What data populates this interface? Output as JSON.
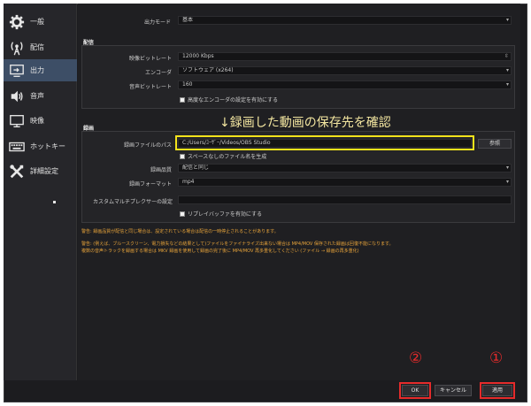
{
  "sidebar": {
    "items": [
      {
        "label": "一般",
        "icon": "gear-icon"
      },
      {
        "label": "配信",
        "icon": "broadcast-icon"
      },
      {
        "label": "出力",
        "icon": "output-icon"
      },
      {
        "label": "音声",
        "icon": "speaker-icon"
      },
      {
        "label": "映像",
        "icon": "monitor-icon"
      },
      {
        "label": "ホットキー",
        "icon": "keyboard-icon"
      },
      {
        "label": "詳細設定",
        "icon": "tools-icon"
      }
    ],
    "active_index": 2
  },
  "output_mode": {
    "label": "出力モード",
    "value": "基本"
  },
  "streaming": {
    "title": "配信",
    "video_bitrate_label": "映像ビットレート",
    "video_bitrate_value": "12000 Kbps",
    "encoder_label": "エンコーダ",
    "encoder_value": "ソフトウェア (x264)",
    "audio_bitrate_label": "音声ビットレート",
    "audio_bitrate_value": "160",
    "advanced_encoder_checkbox": "高度なエンコーダの設定を有効にする"
  },
  "recording": {
    "title": "録画",
    "annotation": "↓録画した動画の保存先を確認",
    "path_label": "録画ファイルのパス",
    "path_value": "C:/Users/ﾕｰｻﾞｰ/Videos/OBS Studio",
    "browse_label": "参照",
    "nospace_checkbox": "スペースなしのファイル名を生成",
    "quality_label": "録画品質",
    "quality_value": "配信と同じ",
    "format_label": "録画フォーマット",
    "format_value": "mp4",
    "muxer_label": "カスタムマルチプレクサーの設定",
    "replay_checkbox": "リプレイバッファを有効にする"
  },
  "warnings": {
    "line1": "警告: 録画品質が配信と同じ場合は、設定されている場合は配信の一時停止されることがあります。",
    "line2": "警告: (例えば、ブルースクリーン、電力損失などの結果として)ファイルをファイナライズ出来ない場合は MP4/MOV 保存された録画は回復不能になります。",
    "line3": "複数の音声トラックを録画する場合は MKV 録画を使用して録画の完了後に MP4/MOV 再多重化してください (ファイル → 録画の再多重化)"
  },
  "buttons": {
    "ok": "OK",
    "cancel": "キャンセル",
    "apply": "適用"
  },
  "markers": {
    "apply_marker": "①",
    "ok_marker": "②"
  },
  "colors": {
    "highlight_yellow": "#f2e21b",
    "marker_red": "#e52b2b",
    "warning_orange": "#e8a43a",
    "active_blue": "#3d4e66"
  }
}
